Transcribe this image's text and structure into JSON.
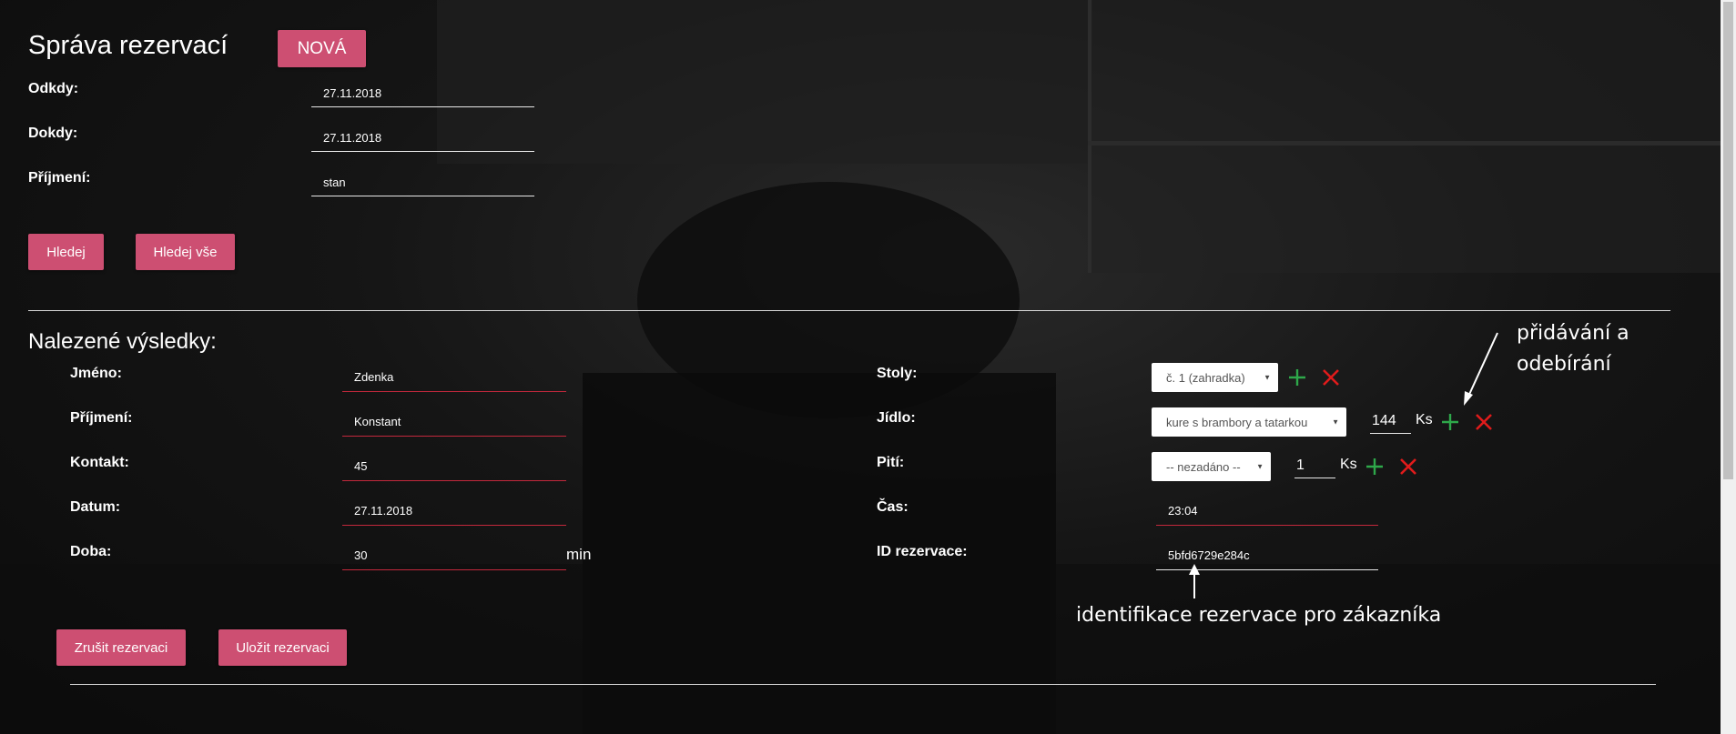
{
  "search": {
    "title": "Správa rezervací",
    "new_label": "NOVÁ",
    "fields": [
      {
        "label": "Odkdy:",
        "value": "27.11.2018"
      },
      {
        "label": "Dokdy:",
        "value": "27.11.2018"
      },
      {
        "label": "Příjmení:",
        "value": "stan"
      }
    ],
    "search_label": "Hledej",
    "search_all_label": "Hledej vše"
  },
  "results": {
    "title": "Nalezené výsledky:",
    "left": [
      {
        "label": "Jméno:",
        "value": "Zdenka"
      },
      {
        "label": "Příjmení:",
        "value": "Konstant"
      },
      {
        "label": "Kontakt:",
        "value": "45"
      },
      {
        "label": "Datum:",
        "value": "27.11.2018"
      },
      {
        "label": "Doba:",
        "value": "30",
        "unit": "min"
      }
    ],
    "tables": {
      "label": "Stoly:",
      "selected": "č. 1 (zahradka)"
    },
    "food": {
      "label": "Jídlo:",
      "selected": "kure s brambory a tatarkou",
      "qty": "144",
      "unit": "Ks"
    },
    "drink": {
      "label": "Pití:",
      "selected": "-- nezadáno --",
      "qty": "1",
      "unit": "Ks"
    },
    "time": {
      "label": "Čas:",
      "value": "23:04"
    },
    "reservation_id": {
      "label": "ID rezervace:",
      "value": "5bfd6729e284c"
    },
    "cancel_label": "Zrušit rezervaci",
    "save_label": "Uložit rezervaci"
  },
  "annotations": {
    "add_remove": [
      "přidávání a",
      "odebírání"
    ],
    "id_note": "identifikace rezervace pro zákazníka"
  },
  "colors": {
    "accent": "#cd4f72",
    "add": "#2ea84a",
    "remove": "#e01b1b",
    "underline_error": "#c3283c"
  }
}
